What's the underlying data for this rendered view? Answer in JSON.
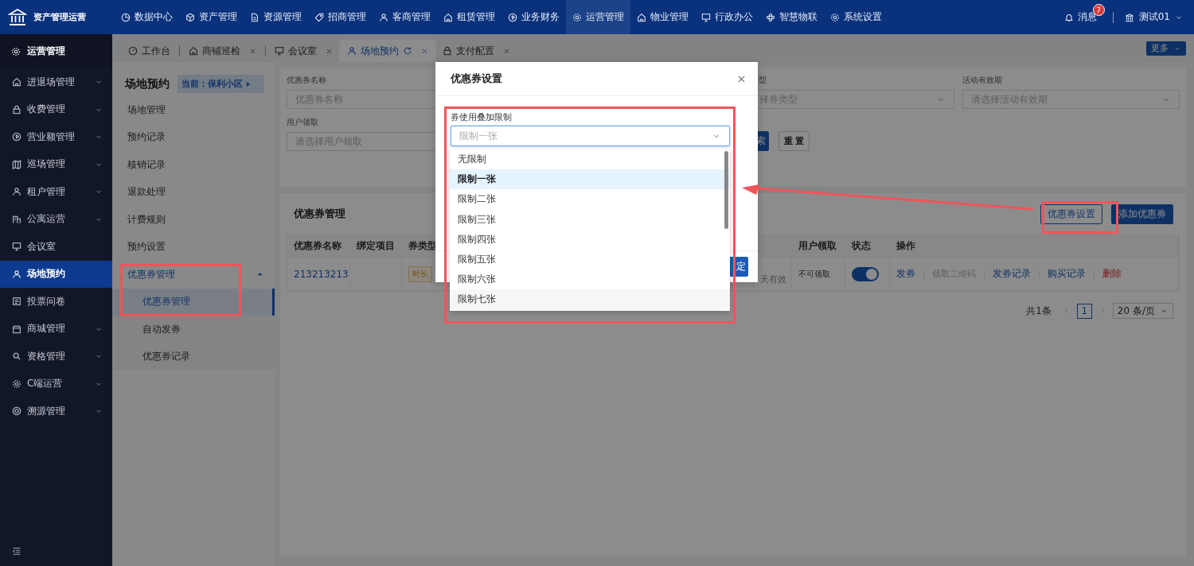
{
  "app": {
    "title": "资产管理运营"
  },
  "top_nav": [
    {
      "label": "数据中心",
      "selected": false
    },
    {
      "label": "资产管理",
      "selected": false
    },
    {
      "label": "资源管理",
      "selected": false
    },
    {
      "label": "招商管理",
      "selected": false
    },
    {
      "label": "客商管理",
      "selected": false
    },
    {
      "label": "租赁管理",
      "selected": false
    },
    {
      "label": "业务财务",
      "selected": false
    },
    {
      "label": "运营管理",
      "selected": true
    },
    {
      "label": "物业管理",
      "selected": false
    },
    {
      "label": "行政办公",
      "selected": false
    },
    {
      "label": "智慧物联",
      "selected": false
    },
    {
      "label": "系统设置",
      "selected": false
    }
  ],
  "header_right": {
    "messages": {
      "label": "消息",
      "badge": "7"
    },
    "user": "测试01"
  },
  "sidebar": {
    "title": "运营管理",
    "items": [
      {
        "label": "进退场管理",
        "expandable": true,
        "selected": false
      },
      {
        "label": "收费管理",
        "expandable": true,
        "selected": false
      },
      {
        "label": "营业额管理",
        "expandable": true,
        "selected": false
      },
      {
        "label": "巡场管理",
        "expandable": true,
        "selected": false
      },
      {
        "label": "租户管理",
        "expandable": true,
        "selected": false
      },
      {
        "label": "公寓运营",
        "expandable": true,
        "selected": false
      },
      {
        "label": "会议室",
        "expandable": false,
        "selected": false
      },
      {
        "label": "场地预约",
        "expandable": false,
        "selected": true
      },
      {
        "label": "投票问卷",
        "expandable": false,
        "selected": false
      },
      {
        "label": "商城管理",
        "expandable": true,
        "selected": false
      },
      {
        "label": "资格管理",
        "expandable": true,
        "selected": false
      },
      {
        "label": "C端运营",
        "expandable": true,
        "selected": false
      },
      {
        "label": "溯源管理",
        "expandable": true,
        "selected": false
      }
    ]
  },
  "tabs": [
    {
      "label": "工作台",
      "closable": false,
      "selected": false
    },
    {
      "label": "商铺巡检",
      "closable": true,
      "selected": false
    },
    {
      "label": "会议室",
      "closable": true,
      "selected": false
    },
    {
      "label": "场地预约",
      "closable": true,
      "selected": true
    },
    {
      "label": "支付配置",
      "closable": true,
      "selected": false
    }
  ],
  "more_button": "更多",
  "sub_menu": {
    "title": "场地预约",
    "scope": "当前：保利小区",
    "items": [
      {
        "label": "场地管理",
        "selected": false
      },
      {
        "label": "预约记录",
        "selected": false
      },
      {
        "label": "核销记录",
        "selected": false
      },
      {
        "label": "退款处理",
        "selected": false
      },
      {
        "label": "计费规则",
        "selected": false
      },
      {
        "label": "预约设置",
        "selected": false
      },
      {
        "label": "优惠券管理",
        "selected": false,
        "expanded": true,
        "children": [
          {
            "label": "优惠券管理",
            "selected": true
          },
          {
            "label": "自动发券",
            "selected": false
          },
          {
            "label": "优惠券记录",
            "selected": false
          }
        ]
      }
    ]
  },
  "filters": [
    {
      "label": "优惠券名称",
      "placeholder": "优惠券名称",
      "kind": "input"
    },
    {
      "label": "型",
      "placeholder": "择券类型",
      "kind": "select",
      "partly_hidden": true
    },
    {
      "label": "活动有效期",
      "placeholder": "请选择活动有效期",
      "kind": "select"
    },
    {
      "label": "用户领取",
      "placeholder": "请选择用户领取",
      "kind": "select"
    }
  ],
  "filter_buttons": [
    {
      "label": "索",
      "kind": "primary"
    },
    {
      "label": "重 置",
      "kind": "default"
    }
  ],
  "coupon_panel": {
    "title": "优惠券管理",
    "buttons": [
      {
        "label": "优惠券设置",
        "kind": "outline"
      },
      {
        "label": "添加优惠券",
        "kind": "primary"
      }
    ],
    "columns": [
      "优惠券名称",
      "绑定项目",
      "券类型",
      "用户领取",
      "状态",
      "操作"
    ],
    "rows": [
      {
        "name": "213213213",
        "type_tag": "时长",
        "validity": "天有效",
        "user_claim": "不可领取",
        "on": true,
        "actions": [
          {
            "label": "发券",
            "kind": "link"
          },
          {
            "label": "领取二维码",
            "kind": "disabled"
          },
          {
            "label": "发券记录",
            "kind": "link"
          },
          {
            "label": "购买记录",
            "kind": "link"
          },
          {
            "label": "删除",
            "kind": "danger"
          }
        ]
      }
    ],
    "pagination": {
      "total": "共1条",
      "pages": [
        {
          "label": "1",
          "selected": true
        }
      ],
      "page_size": "20 条/页"
    }
  },
  "modal": {
    "title": "优惠券设置",
    "field_label": "券使用叠加限制",
    "placeholder": "限制一张",
    "footer_button": "定",
    "options": [
      {
        "label": "无限制",
        "selected": false
      },
      {
        "label": "限制一张",
        "selected": true
      },
      {
        "label": "限制二张",
        "selected": false
      },
      {
        "label": "限制三张",
        "selected": false
      },
      {
        "label": "限制四张",
        "selected": false
      },
      {
        "label": "限制五张",
        "selected": false
      },
      {
        "label": "限制六张",
        "selected": false
      },
      {
        "label": "限制七张",
        "selected": false
      }
    ]
  }
}
